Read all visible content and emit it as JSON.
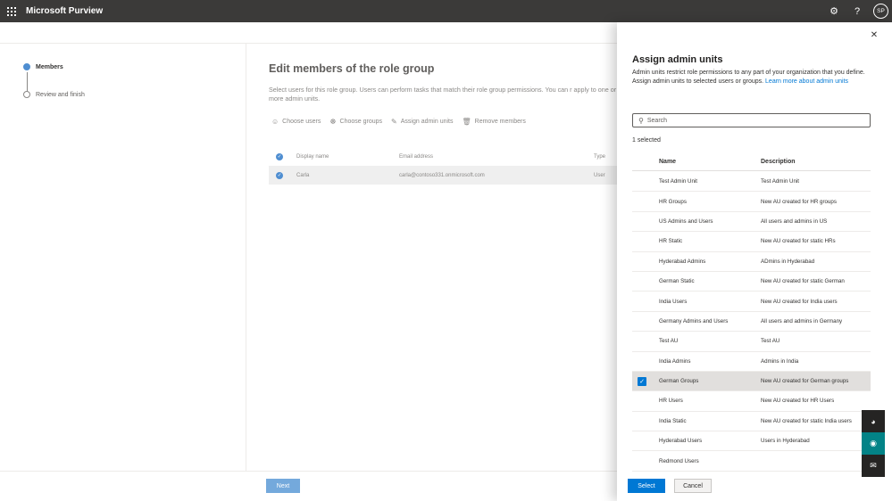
{
  "app": {
    "title": "Microsoft Purview",
    "avatar_initials": "SP"
  },
  "steps": [
    {
      "label": "Members",
      "state": "active"
    },
    {
      "label": "Review and finish",
      "state": "inactive"
    }
  ],
  "main": {
    "title": "Edit members of the role group",
    "description": "Select users for this role group. Users can perform tasks that match their role group permissions. You can r apply to one or more admin units.",
    "commands": {
      "choose_users": "Choose users",
      "choose_groups": "Choose groups",
      "assign_admin_units": "Assign admin units",
      "remove_members": "Remove members"
    },
    "table": {
      "headers": {
        "display_name": "Display name",
        "email": "Email address",
        "type": "Type"
      },
      "rows": [
        {
          "display_name": "Carla",
          "email": "carla@contoso331.onmicrosoft.com",
          "type": "User"
        }
      ]
    },
    "next_label": "Next"
  },
  "panel": {
    "title": "Assign admin units",
    "description": "Admin units restrict role permissions to any part of your organization that you define. Assign admin units to selected users or groups.",
    "learn_more": "Learn more about admin units",
    "search_placeholder": "Search",
    "selected_count": "1 selected",
    "headers": {
      "name": "Name",
      "description": "Description"
    },
    "units": [
      {
        "name": "Test Admin Unit",
        "description": "Test Admin Unit"
      },
      {
        "name": "HR Groups",
        "description": "New AU created for HR groups"
      },
      {
        "name": "US Admins and Users",
        "description": "All users and admins in US"
      },
      {
        "name": "HR Static",
        "description": "New AU created for static HRs"
      },
      {
        "name": "Hyderabad Admins",
        "description": "ADmins in Hyderabad"
      },
      {
        "name": "German Static",
        "description": "New AU created for static German"
      },
      {
        "name": "India Users",
        "description": "New AU created for India users"
      },
      {
        "name": "Germany Admins and Users",
        "description": "All users and admins in Germany"
      },
      {
        "name": "Test AU",
        "description": "Test AU"
      },
      {
        "name": "India Admins",
        "description": "Admins in India"
      },
      {
        "name": "German Groups",
        "description": "New AU created for German groups",
        "selected": true
      },
      {
        "name": "HR Users",
        "description": "New AU created for HR Users"
      },
      {
        "name": "India Static",
        "description": "New AU created for static India users"
      },
      {
        "name": "Hyderabad Users",
        "description": "Users in Hyderabad"
      },
      {
        "name": "Redmond Users",
        "description": ""
      }
    ],
    "select_label": "Select",
    "cancel_label": "Cancel"
  }
}
